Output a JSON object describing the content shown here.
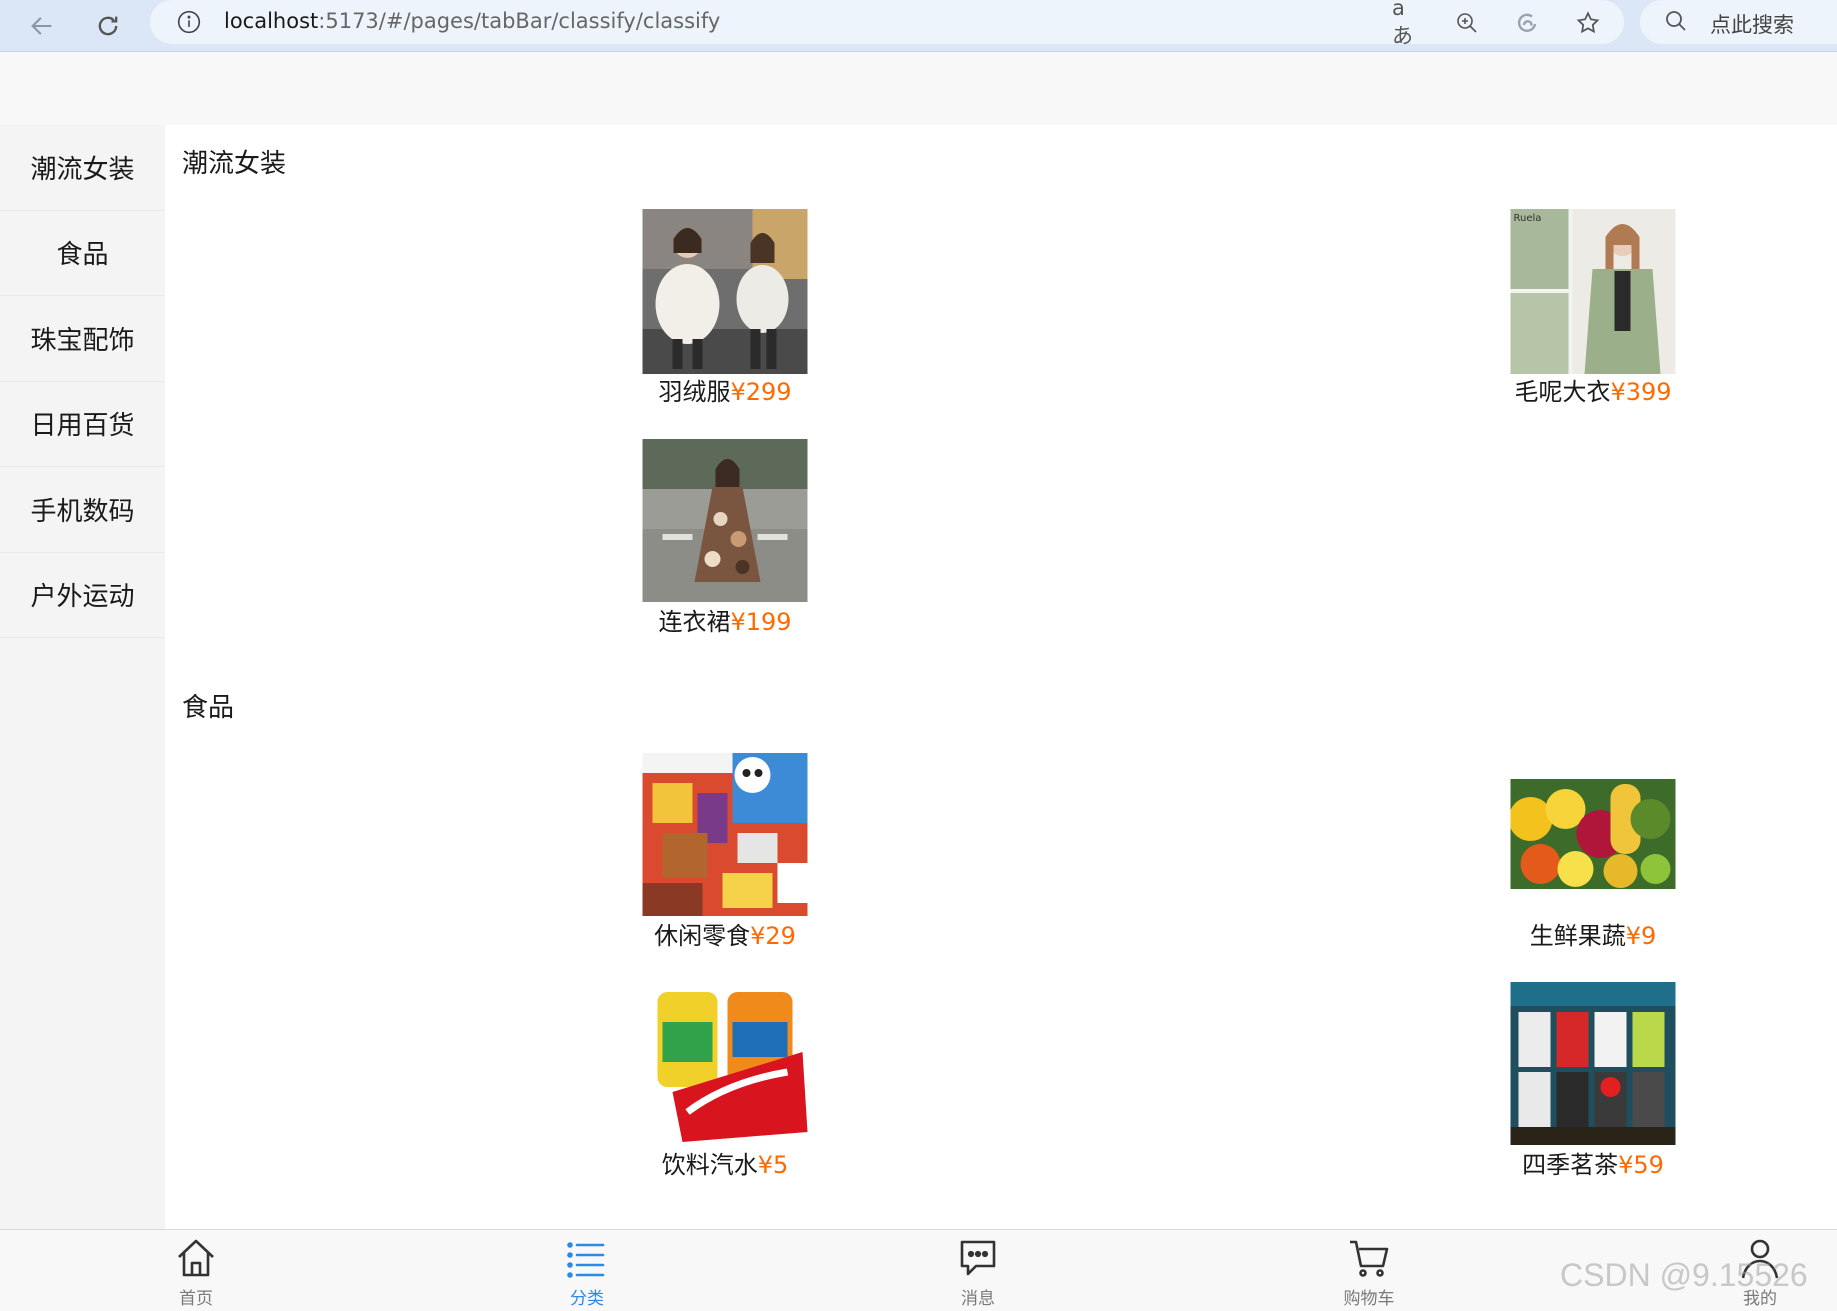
{
  "browser": {
    "url_host": "localhost",
    "url_path": ":5173/#/pages/tabBar/classify/classify",
    "translate_glyph": "aあ",
    "search_placeholder": "点此搜索"
  },
  "sidebar": {
    "items": [
      {
        "label": "潮流女装"
      },
      {
        "label": "食品"
      },
      {
        "label": "珠宝配饰"
      },
      {
        "label": "日用百货"
      },
      {
        "label": "手机数码"
      },
      {
        "label": "户外运动"
      }
    ]
  },
  "sections": [
    {
      "title": "潮流女装",
      "products": [
        {
          "name": "羽绒服",
          "price": "¥299"
        },
        {
          "name": "毛呢大衣",
          "price": "¥399"
        },
        {
          "name": "连衣裙",
          "price": "¥199"
        }
      ]
    },
    {
      "title": "食品",
      "products": [
        {
          "name": "休闲零食",
          "price": "¥29"
        },
        {
          "name": "生鲜果蔬",
          "price": "¥9"
        },
        {
          "name": "饮料汽水",
          "price": "¥5"
        },
        {
          "name": "四季茗茶",
          "price": "¥59"
        }
      ]
    }
  ],
  "tabbar": {
    "items": [
      {
        "label": "首页",
        "icon": "home-icon"
      },
      {
        "label": "分类",
        "icon": "list-icon",
        "active": true
      },
      {
        "label": "消息",
        "icon": "message-icon"
      },
      {
        "label": "购物车",
        "icon": "cart-icon"
      },
      {
        "label": "我的",
        "icon": "user-icon"
      }
    ]
  },
  "colors": {
    "price": "#ff6a00",
    "tab_active": "#2b8ae6",
    "browser_bar": "#dbe7f6"
  },
  "watermark": "CSDN @9.15526"
}
